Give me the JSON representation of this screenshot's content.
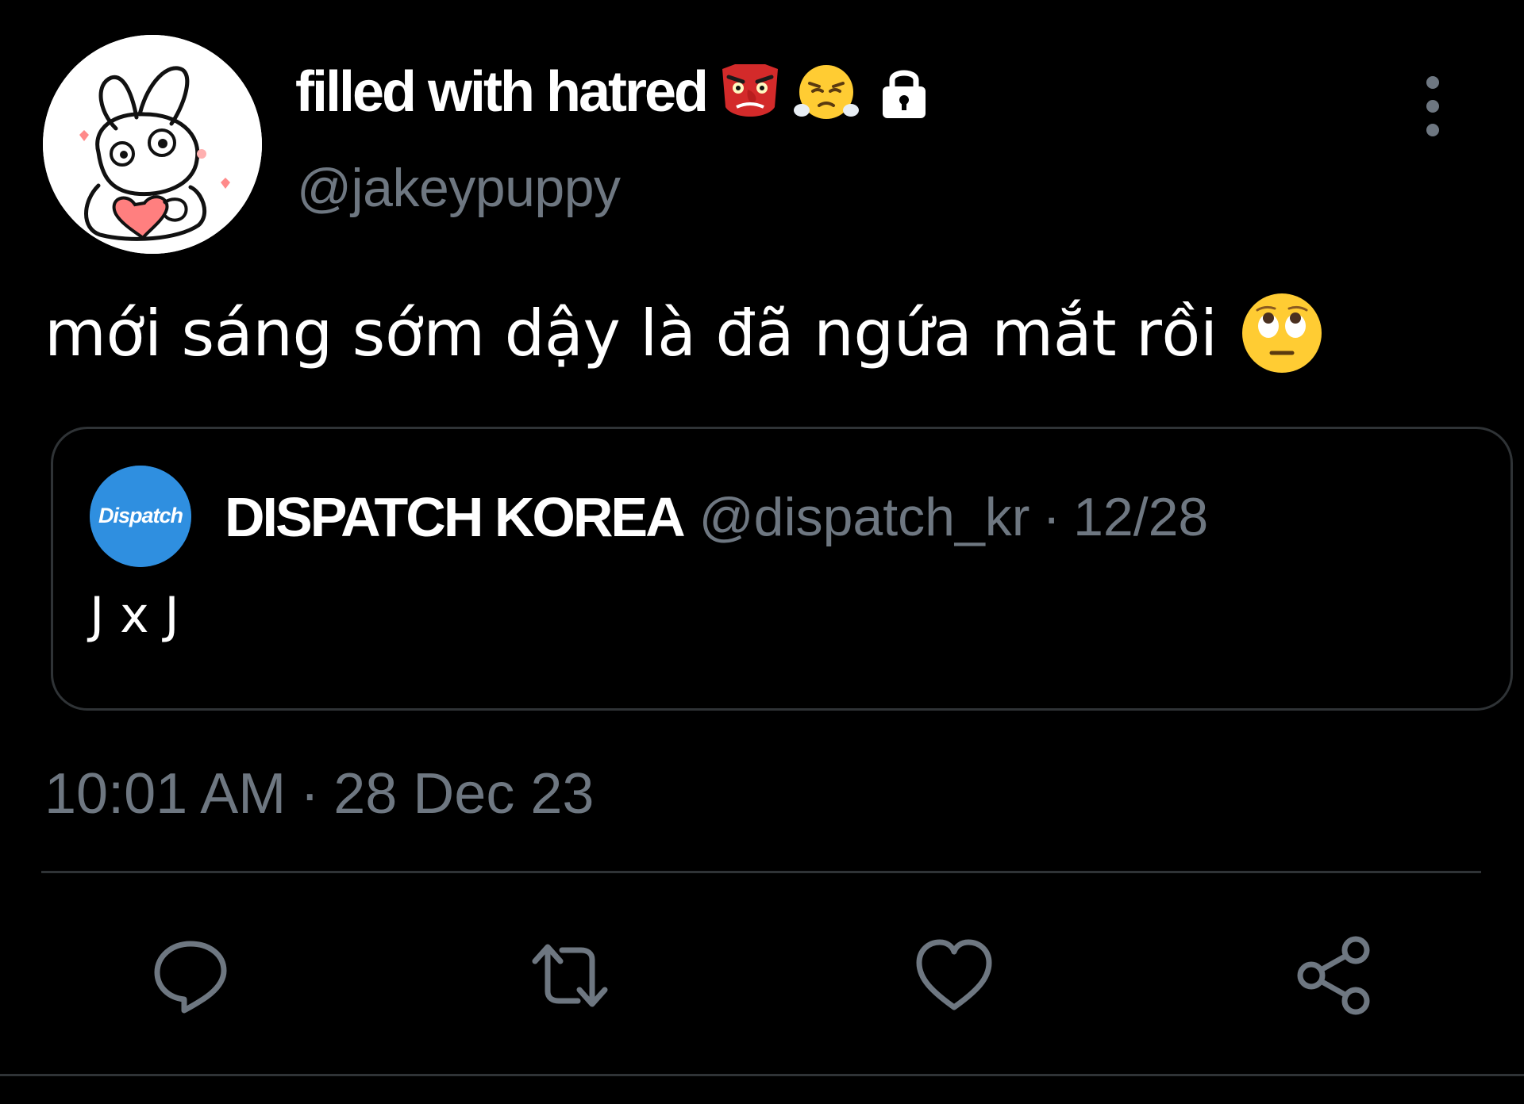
{
  "author": {
    "display_name": "filled with hatred",
    "emojis": [
      "goblin-mask-emoji",
      "face-with-steam-emoji"
    ],
    "locked_icon": "lock-icon",
    "handle": "@jakeypuppy"
  },
  "tweet": {
    "text": "mới sáng sớm dậy là đã ngứa mắt rồi",
    "trailing_emoji": "face-with-rolling-eyes-emoji",
    "time": "10:01 AM",
    "separator": "·",
    "date": "28 Dec 23"
  },
  "quoted": {
    "avatar_label": "Dispatch",
    "name": "DISPATCH KOREA",
    "handle": "@dispatch_kr",
    "separator": "·",
    "date": "12/28",
    "text": "J x J"
  },
  "actions": {
    "reply_icon": "reply-icon",
    "retweet_icon": "retweet-icon",
    "like_icon": "heart-icon",
    "share_icon": "share-icon"
  },
  "colors": {
    "background": "#000000",
    "primary_text": "#ffffff",
    "secondary_text": "#6e7781",
    "border": "#2f3336",
    "dispatch_blue": "#2f8fe0"
  }
}
